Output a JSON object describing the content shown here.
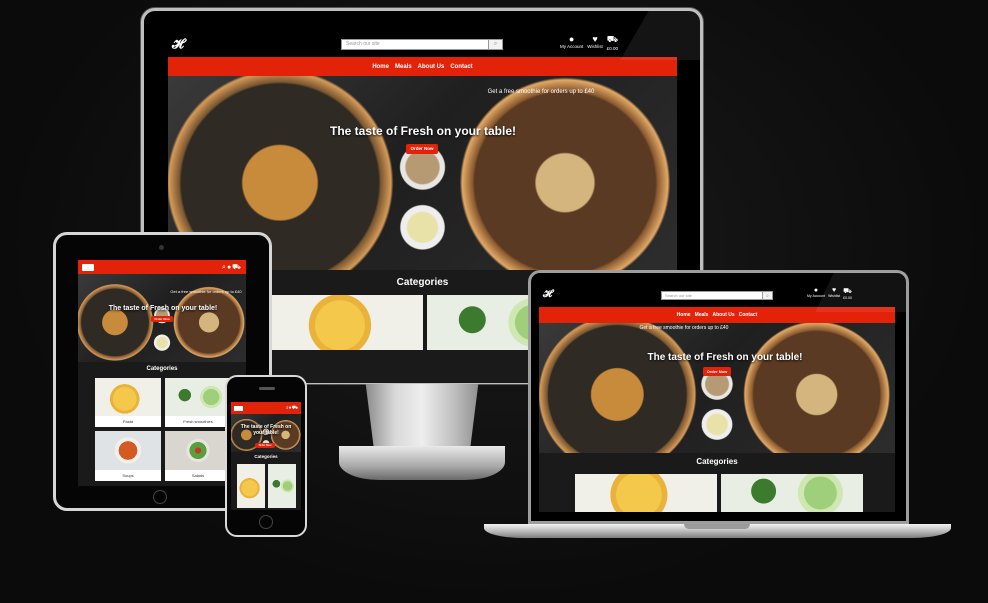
{
  "site": {
    "logo": "𝓗",
    "search_placeholder": "Search our site",
    "account": {
      "my_account": "My Account",
      "wishlist": "Wishlist",
      "basket": "£0.00"
    },
    "nav": [
      "Home",
      "Meals",
      "About Us",
      "Contact"
    ],
    "promo": "Get a free smoothie for orders up to £40",
    "headline": "The taste of Fresh on your table!",
    "cta": "Order Now",
    "categories_title": "Categories",
    "categories": [
      "Pasta",
      "Fresh smoothies",
      "Soups",
      "Salads"
    ],
    "tablet_promo": "Get a free smoothie for orders up to £40"
  },
  "icons": {
    "search": "search-icon",
    "account": "user-icon",
    "wishlist": "heart-icon",
    "basket": "basket-icon",
    "menu": "hamburger-icon"
  },
  "colors": {
    "brand_red": "#e2230a",
    "background": "#0d0d0d",
    "page_dark": "#141414"
  }
}
